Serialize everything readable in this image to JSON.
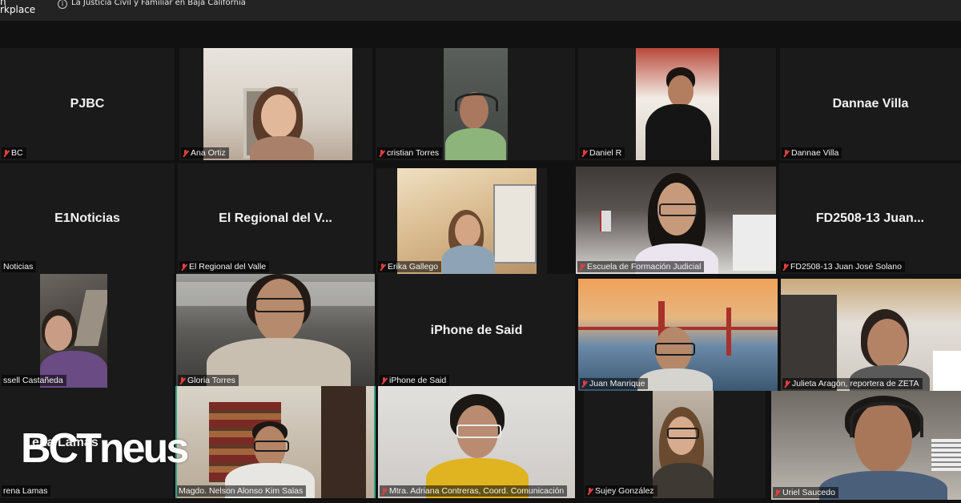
{
  "app": {
    "name_line1": "n",
    "name_line2": "rkplace"
  },
  "meeting": {
    "title": "La Justicia Civil y Familiar en Baja California",
    "info_icon": "info-icon"
  },
  "participants": [
    {
      "center_label": "PJBC",
      "name_tag": "BC",
      "video": false
    },
    {
      "center_label": "",
      "name_tag": "Ana Ortiz",
      "video": true
    },
    {
      "center_label": "",
      "name_tag": "cristian Torres",
      "video": true
    },
    {
      "center_label": "",
      "name_tag": "Daniel R",
      "video": true
    },
    {
      "center_label": "Dannae Villa",
      "name_tag": "Dannae Villa",
      "video": false
    },
    {
      "center_label": "E1Noticias",
      "name_tag": "Noticias",
      "video": false
    },
    {
      "center_label": "El Regional del V...",
      "name_tag": "El Regional del Valle",
      "video": false
    },
    {
      "center_label": "",
      "name_tag": "Erika Gallego",
      "video": true
    },
    {
      "center_label": "",
      "name_tag": "Escuela de Formación Judicial",
      "video": true
    },
    {
      "center_label": "FD2508-13  Juan...",
      "name_tag": "FD2508-13 Juan José Solano",
      "video": false
    },
    {
      "center_label": "",
      "name_tag": "ssell Castañeda",
      "video": true
    },
    {
      "center_label": "",
      "name_tag": "Gloria Torres",
      "video": true
    },
    {
      "center_label": "iPhone de Said",
      "name_tag": "iPhone de Said",
      "video": false
    },
    {
      "center_label": "",
      "name_tag": "Juan Manrique",
      "video": true
    },
    {
      "center_label": "",
      "name_tag": "Julieta Aragón, reportera de ZETA",
      "video": true
    },
    {
      "center_label": "ena Lamas",
      "name_tag": "rena Lamas",
      "video": false
    },
    {
      "center_label": "",
      "name_tag": "Magdo. Nelson Alonso Kim Salas",
      "video": true,
      "speaking": true
    },
    {
      "center_label": "",
      "name_tag": "Mtra. Adriana Contreras, Coord. Comunicación",
      "video": true
    },
    {
      "center_label": "",
      "name_tag": "Sujey González",
      "video": true
    },
    {
      "center_label": "",
      "name_tag": "Uriel Saucedo",
      "video": true
    }
  ],
  "watermark": {
    "text": "BCTneus"
  },
  "colors": {
    "muted": "#e04040",
    "active_speaker": "#2fa58a",
    "background": "#111111"
  }
}
